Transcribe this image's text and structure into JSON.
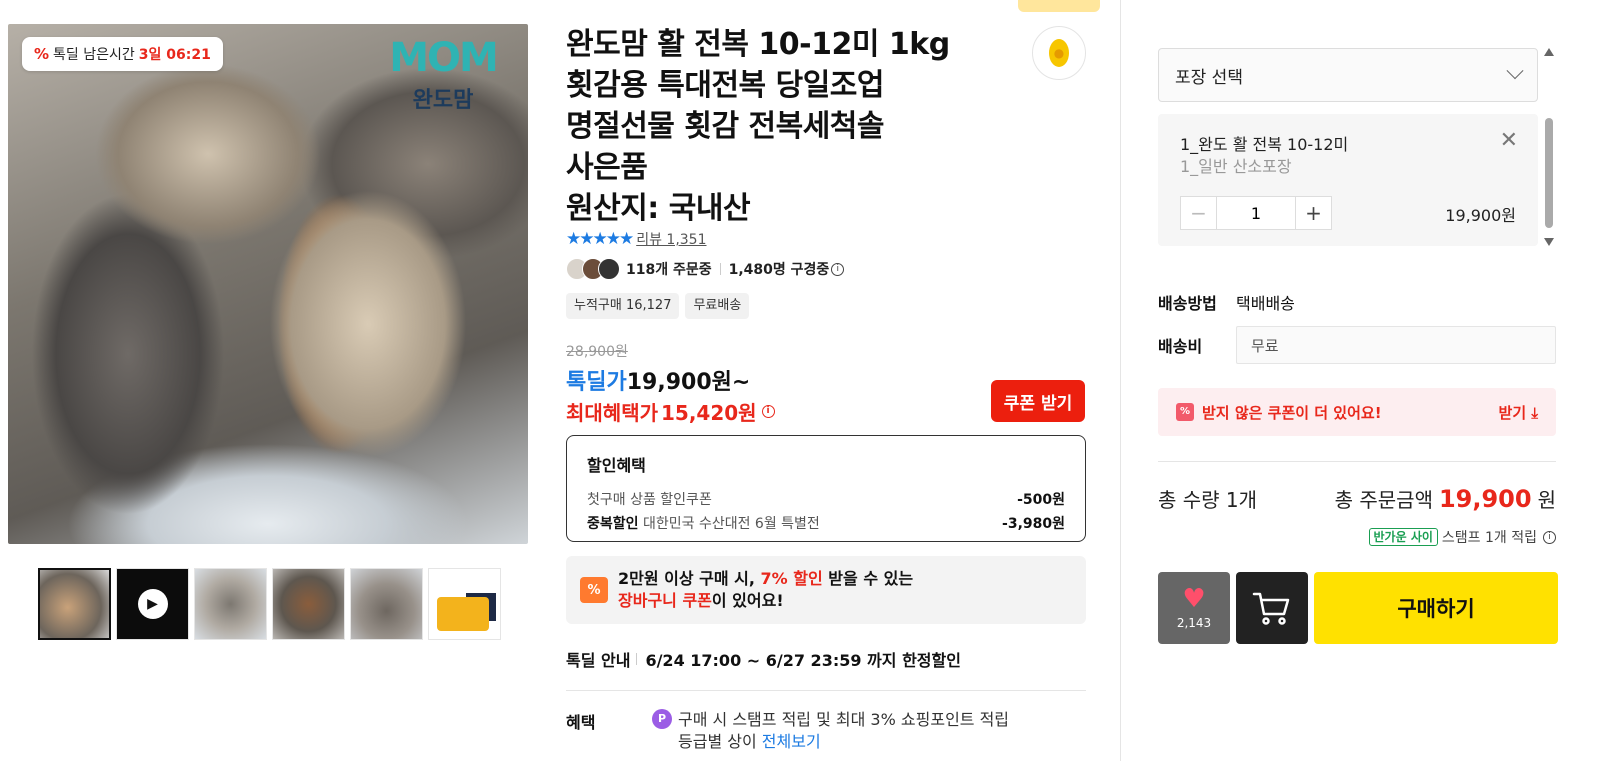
{
  "product_images": {
    "timer_badge": {
      "icon": "%",
      "label": "톡딜 남은시간",
      "value": "3일 06:21"
    },
    "brand_logo": {
      "text": "MOM",
      "sub": "완도맘"
    },
    "thumbnails": [
      {
        "name": "thumb-1"
      },
      {
        "name": "thumb-2-video"
      },
      {
        "name": "thumb-3"
      },
      {
        "name": "thumb-4"
      },
      {
        "name": "thumb-5"
      },
      {
        "name": "thumb-6"
      }
    ]
  },
  "product": {
    "title_lines": [
      "완도맘 활 전복 10-12미 1kg",
      "횟감용 특대전복 당일조업",
      "명절선물 횟감 전복세척솔",
      "사은품",
      "원산지: 국내산"
    ],
    "rating_stars": "★★★★★",
    "review_link": "리뷰 1,351",
    "ordering": "118개 주문중",
    "browsing": "1,480명 구경중",
    "chips": [
      "누적구매 16,127",
      "무료배송"
    ],
    "original_price": "28,900원",
    "deal_label": "톡딜가",
    "deal_price": "19,900원~",
    "max_benefit_label": "최대혜택가",
    "max_benefit_price": "15,420원",
    "coupon_button": "쿠폰 받기",
    "discount": {
      "title": "할인혜택",
      "rows": [
        {
          "label": "첫구매 상품 할인쿠폰",
          "strong": "",
          "value": "-500원"
        },
        {
          "label": "대한민국 수산대전 6월 특별전",
          "strong": "중복할인",
          "value": "-3,980원"
        }
      ]
    },
    "cart_coupon": {
      "icon": "%",
      "line1_pre": "2만원 이상 구매 시, ",
      "line1_red": "7% 할인",
      "line1_post": " 받을 수 있는",
      "line2_red": "장바구니 쿠폰",
      "line2_post": "이 있어요!"
    },
    "deal_info": {
      "label": "톡딜 안내",
      "value": "6/24 17:00 ~ 6/27 23:59 까지 한정할인"
    },
    "benefit": {
      "label": "혜택",
      "icon": "P",
      "line1": "구매 시 스탬프 적립 및 최대 3% 쇼핑포인트 적립",
      "line2_pre": "등급별 상이",
      "line2_link": "전체보기"
    }
  },
  "order_panel": {
    "select_label": "포장 선택",
    "option": {
      "name": "1_완도 활 전복 10-12미",
      "sub": "1_일반 산소포장",
      "quantity": "1",
      "price": "19,900원"
    },
    "shipping_method_label": "배송방법",
    "shipping_method_value": "택배배송",
    "shipping_fee_label": "배송비",
    "shipping_fee_value": "무료",
    "unclaimed_coupon": "받지 않은 쿠폰이 더 있어요!",
    "unclaimed_action": "받기",
    "total_qty": "총 수량 1개",
    "total_amount_label": "총 주문금액",
    "total_amount_value": "19,900",
    "total_amount_unit": "원",
    "stamp_badge": "반가운 사이",
    "stamp_text": "스탬프 1개 적립",
    "wish_count": "2,143",
    "buy_button": "구매하기"
  },
  "colors": {
    "accent_red": "#e8271b",
    "deal_blue": "#1d7be2",
    "buy_yellow": "#ffe100"
  }
}
